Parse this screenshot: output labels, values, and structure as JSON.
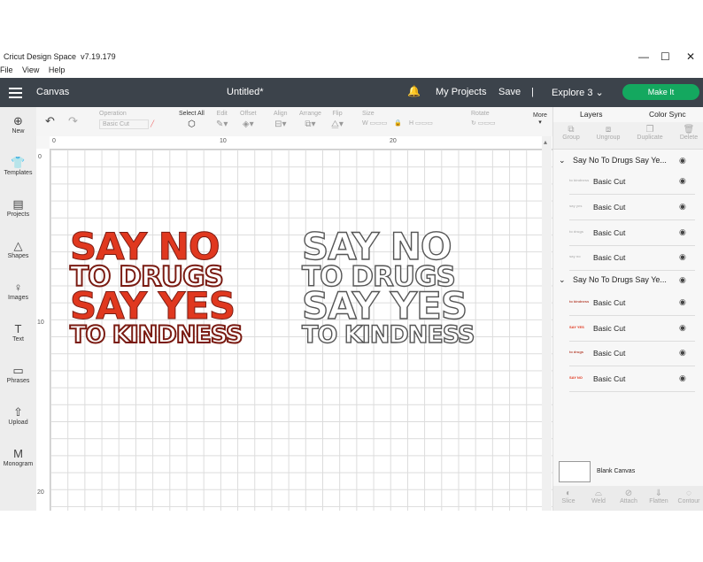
{
  "window": {
    "app_title": "Cricut Design Space",
    "version": "v7.19.179",
    "min_glyph": "—",
    "max_glyph": "☐",
    "close_glyph": "✕"
  },
  "menu": [
    "File",
    "View",
    "Help"
  ],
  "header": {
    "canvas_label": "Canvas",
    "doc_title": "Untitled*",
    "my_projects": "My Projects",
    "save": "Save",
    "separator": "|",
    "machine": "Explore 3",
    "make_it": "Make It"
  },
  "sidebar": [
    {
      "label": "New",
      "icon": "⊕"
    },
    {
      "label": "Templates",
      "icon": "👕"
    },
    {
      "label": "Projects",
      "icon": "▤"
    },
    {
      "label": "Shapes",
      "icon": "△"
    },
    {
      "label": "Images",
      "icon": "♀"
    },
    {
      "label": "Text",
      "icon": "T"
    },
    {
      "label": "Phrases",
      "icon": "▭"
    },
    {
      "label": "Upload",
      "icon": "⇧"
    },
    {
      "label": "Monogram",
      "icon": "M"
    }
  ],
  "toolbar": {
    "undo": "↶",
    "redo": "↷",
    "operation_label": "Operation",
    "operation_value": "Basic Cut",
    "select_all": "Select All",
    "edit": "Edit",
    "offset": "Offset",
    "align": "Align",
    "arrange": "Arrange",
    "flip": "Flip",
    "size": "Size",
    "w": "W",
    "h": "H",
    "rotate": "Rotate",
    "more": "More"
  },
  "ruler": {
    "x": [
      "0",
      "10",
      "20"
    ],
    "y": [
      "0",
      "10",
      "20"
    ]
  },
  "design": {
    "line1": "SAY NO",
    "line2": "TO DRUGS",
    "line3": "SAY YES",
    "line4": "TO KINDNESS"
  },
  "panel": {
    "tab_layers": "Layers",
    "tab_color_sync": "Color Sync",
    "actions": [
      "Group",
      "Ungroup",
      "Duplicate",
      "Delete"
    ],
    "groups": [
      {
        "name": "Say No To Drugs Say Ye...",
        "layers": [
          {
            "name": "Basic Cut",
            "thumb": "to kindness",
            "color": "#bbbbbb"
          },
          {
            "name": "Basic Cut",
            "thumb": "say yes",
            "color": "#bbbbbb"
          },
          {
            "name": "Basic Cut",
            "thumb": "to drugs",
            "color": "#bbbbbb"
          },
          {
            "name": "Basic Cut",
            "thumb": "say no",
            "color": "#bbbbbb"
          }
        ]
      },
      {
        "name": "Say No To Drugs Say Ye...",
        "layers": [
          {
            "name": "Basic Cut",
            "thumb": "to kindness",
            "color": "#b84a3a"
          },
          {
            "name": "Basic Cut",
            "thumb": "SAY YES",
            "color": "#e0381f"
          },
          {
            "name": "Basic Cut",
            "thumb": "to drugs",
            "color": "#b84a3a"
          },
          {
            "name": "Basic Cut",
            "thumb": "SAY NO",
            "color": "#e0381f"
          }
        ]
      }
    ],
    "blank_canvas": "Blank Canvas",
    "bottom": [
      "Slice",
      "Weld",
      "Attach",
      "Flatten",
      "Contour"
    ]
  }
}
